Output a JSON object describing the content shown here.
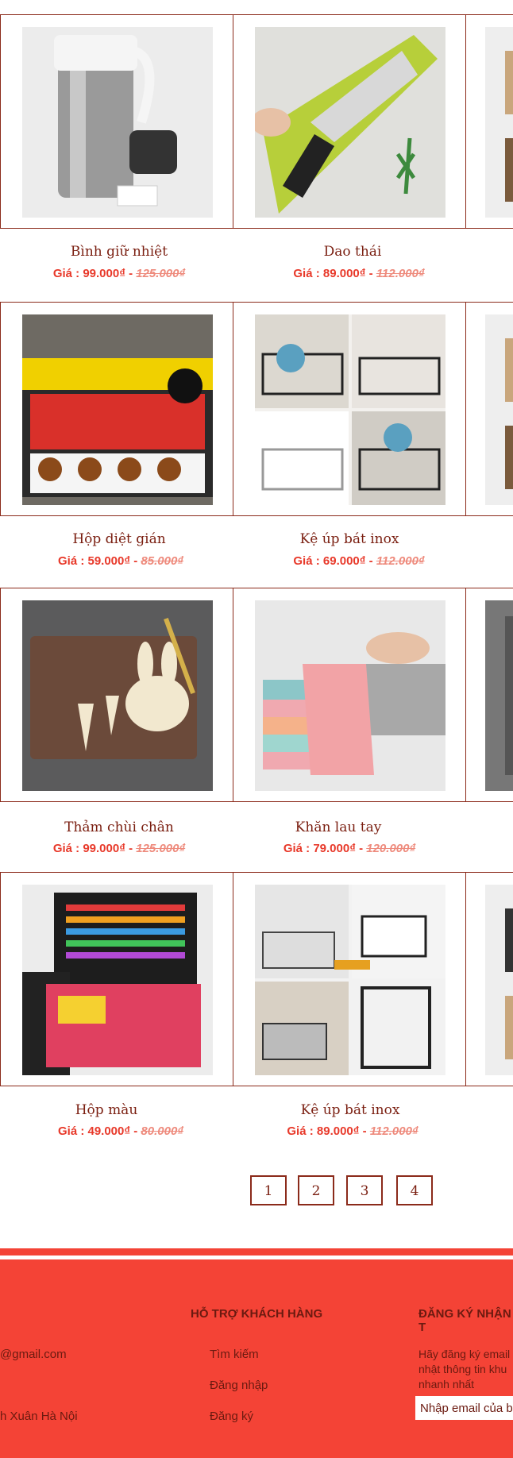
{
  "products": [
    {
      "name": "Bình giữ nhiệt",
      "price_label": "Giá : 99.000₫",
      "sep": "-",
      "old_price": "125.000₫",
      "image": "thermos-image"
    },
    {
      "name": "Dao thái",
      "price_label": "Giá :  89.000₫",
      "sep": "-",
      "old_price": "112.000₫",
      "image": "knife-image"
    },
    {
      "name": "Hộp diệt gián",
      "price_label": "Giá : 59.000₫",
      "sep": "-",
      "old_price": "85.000₫",
      "image": "roach-trap-image"
    },
    {
      "name": "Kệ úp bát inox",
      "price_label": "Giá :  69.000₫",
      "sep": "-",
      "old_price": "112.000₫",
      "image": "dish-rack-image"
    },
    {
      "name": "Thảm chùi chân",
      "price_label": "Giá : 99.000₫",
      "sep": "-",
      "old_price": "125.000₫",
      "image": "doormat-image"
    },
    {
      "name": "Khăn lau tay",
      "price_label": "Giá :  79.000₫",
      "sep": "-",
      "old_price": "120.000₫",
      "image": "towel-image"
    },
    {
      "name": "Hộp màu",
      "price_label": "Giá : 49.000₫",
      "sep": "-",
      "old_price": "80.000₫",
      "image": "art-set-image"
    },
    {
      "name": "Kệ úp bát inox",
      "price_label": "Giá :  89.000₫",
      "sep": "-",
      "old_price": "112.000₫",
      "image": "microwave-shelf-image"
    }
  ],
  "pagination": [
    "1",
    "2",
    "3",
    "4"
  ],
  "footer": {
    "support_heading": "HỖ TRỢ KHÁCH HÀNG",
    "subscribe_heading": "ĐĂNG KÝ NHẬN T",
    "email_partial": "@gmail.com",
    "address_partial": "h Xuân Hà Nội",
    "links": [
      "Tìm kiếm",
      "Đăng  nhập",
      "Đăng ký"
    ],
    "subscribe_desc": "Hãy đăng ký email nhật thông tin khu nhanh nhất",
    "email_placeholder": "Nhập email của b"
  },
  "colors": {
    "brand_red": "#f44336",
    "border_brown": "#8b2a1a",
    "text_brown": "#7a1e10",
    "price_red": "#e8392a"
  }
}
